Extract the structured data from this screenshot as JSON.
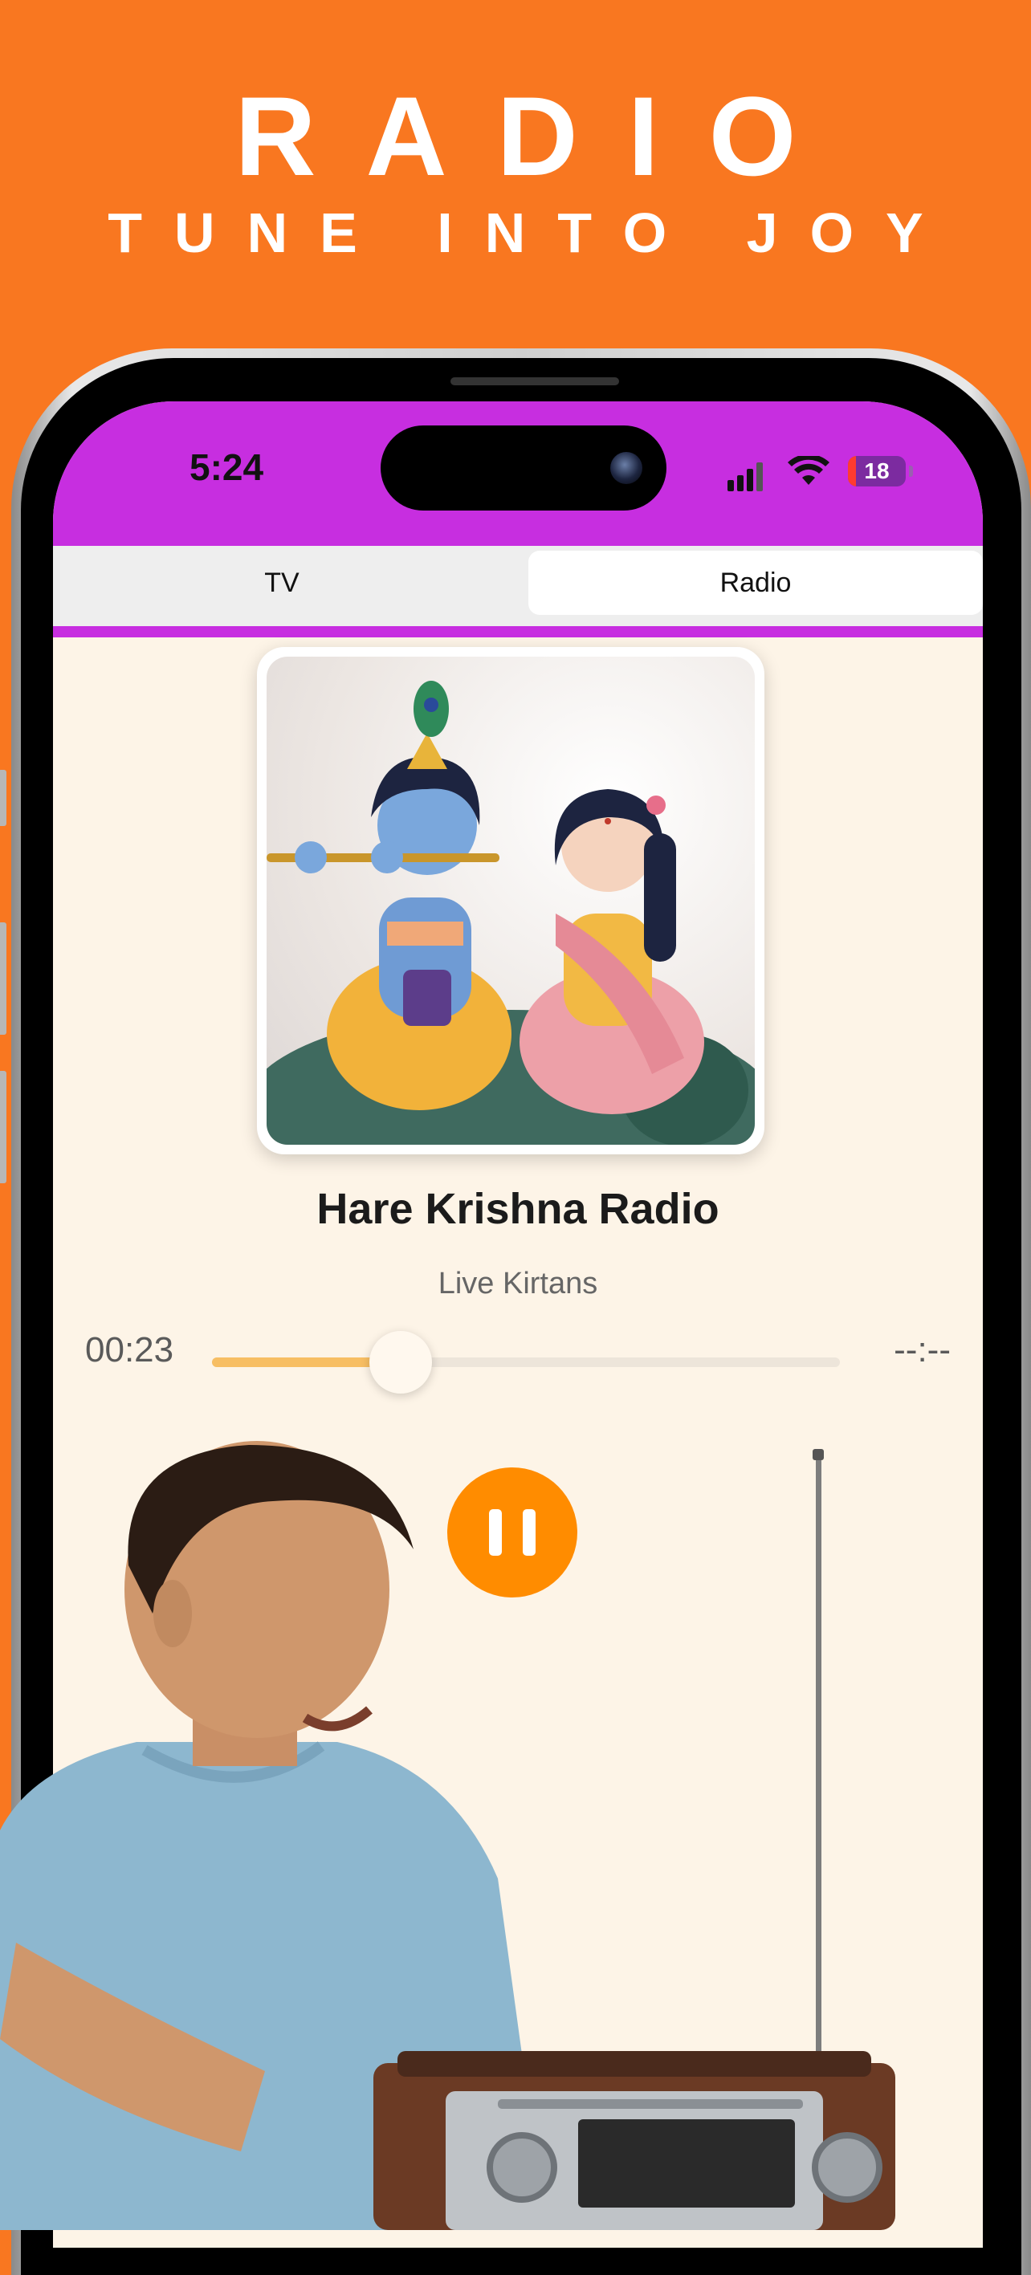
{
  "banner": {
    "headline": "RADIO",
    "tagline": "TUNE INTO JOY",
    "background_color": "#F97720"
  },
  "status_bar": {
    "time": "5:24",
    "battery": "18",
    "background_color": "#C72EE0",
    "icons": [
      "signal-icon",
      "wifi-icon",
      "battery-icon"
    ]
  },
  "tabs": {
    "items": [
      {
        "label": "TV",
        "selected": false
      },
      {
        "label": "Radio",
        "selected": true
      }
    ]
  },
  "player": {
    "station_title": "Hare Krishna Radio",
    "station_subtitle": "Live Kirtans",
    "elapsed": "00:23",
    "remaining": "--:--",
    "progress": 0.3,
    "state": "playing",
    "control_icon": "pause-icon",
    "accent_color": "#FF8C00"
  }
}
